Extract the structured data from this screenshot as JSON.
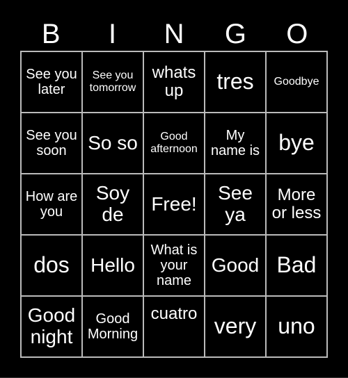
{
  "header": [
    "B",
    "I",
    "N",
    "G",
    "O"
  ],
  "cells": [
    [
      "See you later",
      "See you tomorrow",
      "whats up",
      "tres",
      "Goodbye"
    ],
    [
      "See you soon",
      "So so",
      "Good afternoon",
      "My name is",
      "bye"
    ],
    [
      "How are you",
      "Soy de",
      "Free!",
      "See ya",
      "More or less"
    ],
    [
      "dos",
      "Hello",
      "What is your name",
      "Good",
      "Bad"
    ],
    [
      "Good night",
      "Good Morning",
      "cuatro",
      "very",
      "uno"
    ]
  ],
  "colors": {
    "background": "#000000",
    "text": "#ffffff",
    "border": "#bbbbbb"
  }
}
